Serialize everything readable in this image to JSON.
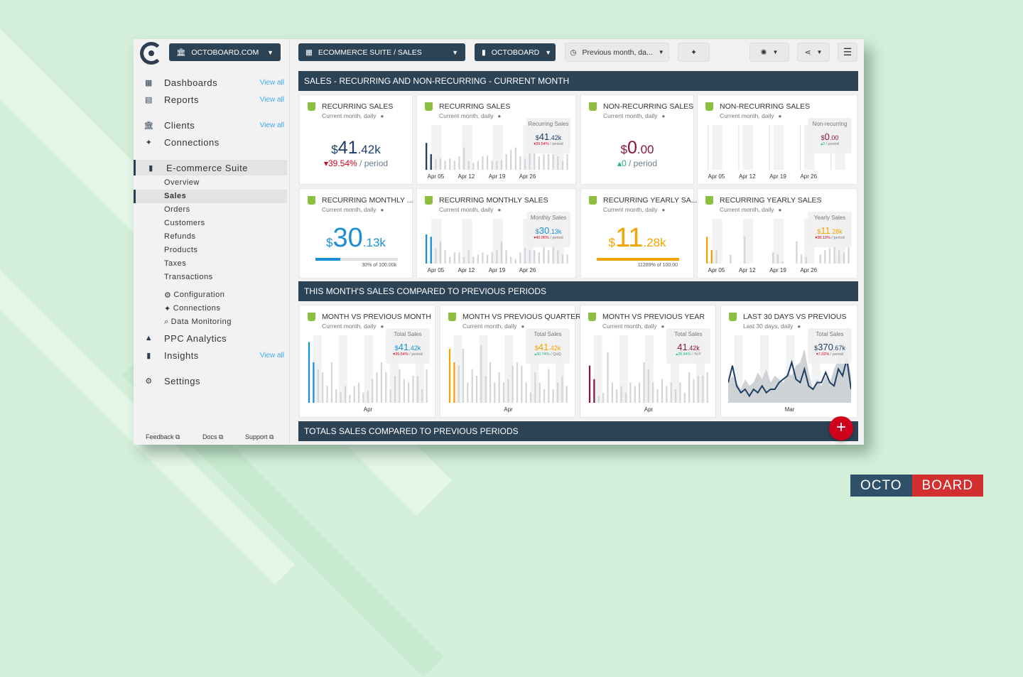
{
  "colors": {
    "dark": "#2c4356",
    "red": "#d0021b",
    "blue": "#1a8fd6",
    "orange": "#f5a300",
    "maroon": "#8a1538",
    "green": "#22b573",
    "navy": "#1d3f66"
  },
  "header": {
    "account": "OCTOBOARD.COM",
    "dashboard": "ECOMMERCE SUITE / SALES",
    "client": "OCTOBOARD",
    "period": "Previous month, da..."
  },
  "sidebar": {
    "items": [
      {
        "label": "Dashboards",
        "view": "View all",
        "icon": "dashboard-icon"
      },
      {
        "label": "Reports",
        "view": "View all",
        "icon": "report-icon"
      },
      {
        "label": "Clients",
        "view": "View all",
        "icon": "bank-icon"
      },
      {
        "label": "Connections",
        "icon": "plug-icon"
      },
      {
        "label": "E-commerce Suite",
        "icon": "shopping-bag-icon"
      }
    ],
    "sub": [
      "Overview",
      "Sales",
      "Orders",
      "Customers",
      "Refunds",
      "Products",
      "Taxes",
      "Transactions"
    ],
    "tools": [
      {
        "label": "Configuration",
        "icon": "gear-icon"
      },
      {
        "label": "Connections",
        "icon": "plug-icon"
      },
      {
        "label": "Data Monitoring",
        "icon": "search-icon"
      }
    ],
    "bottom": [
      {
        "label": "PPC Analytics",
        "icon": "ppc-icon"
      },
      {
        "label": "Insights",
        "view": "View all",
        "icon": "bar-chart-icon"
      },
      {
        "label": "Settings",
        "icon": "gear-icon"
      }
    ],
    "footer": [
      "Feedback",
      "Docs",
      "Support"
    ]
  },
  "sections": [
    "SALES - RECURRING AND NON-RECURRING - CURRENT MONTH",
    "THIS MONTH'S SALES COMPARED TO PREVIOUS PERIODS",
    "TOTALS SALES COMPARED TO PREVIOUS PERIODS"
  ],
  "cards": [
    {
      "title": "RECURRING SALES",
      "sub": "Current month, daily",
      "type": "kpi",
      "cur": "$",
      "int": "41",
      "dec": ".42k",
      "color": "#1d3f66",
      "change": "▾39.54%",
      "changeColor": "#d0021b",
      "per": " / period"
    },
    {
      "title": "RECURRING SALES",
      "sub": "Current month, daily",
      "type": "bars",
      "legend": "Recurring Sales",
      "cur": "$",
      "int": "41",
      "dec": ".42k",
      "color": "#1d3f66",
      "change": "▾39.54%",
      "changeColor": "#d0021b",
      "per": " / period",
      "xlabels": [
        "Apr 05",
        "Apr 12",
        "Apr 19",
        "Apr 26"
      ],
      "hl": 2,
      "bars": [
        0.6,
        0.35,
        0.25,
        0.25,
        0.2,
        0.25,
        0.2,
        0.3,
        0.5,
        0.2,
        0.15,
        0.2,
        0.3,
        0.32,
        0.2,
        0.2,
        0.22,
        0.35,
        0.45,
        0.5,
        0.3,
        0.25,
        0.4,
        0.45,
        0.3,
        0.35,
        0.35,
        0.35,
        0.3,
        0.2,
        0.35
      ]
    },
    {
      "title": "NON-RECURRING SALES",
      "sub": "Current month, daily",
      "type": "kpi",
      "cur": "$",
      "int": "0",
      "dec": ".00",
      "color": "#8a1538",
      "change": "▴0",
      "changeColor": "#22b573",
      "per": " / period"
    },
    {
      "title": "NON-RECURRING SALES",
      "sub": "Current month, daily",
      "type": "bars",
      "legend": "Non-recurring",
      "cur": "$",
      "int": "0",
      "dec": ".00",
      "color": "#8a1538",
      "change": "▴0",
      "changeColor": "#22b573",
      "per": " / period",
      "xlabels": [
        "Apr 05",
        "Apr 12",
        "Apr 19",
        "Apr 26"
      ],
      "hl": 0,
      "bars": []
    },
    {
      "title": "RECURRING MONTHLY ...",
      "sub": "Current month, daily",
      "type": "progress",
      "cur": "$",
      "int": "30",
      "dec": ".13k",
      "color": "#1a8fd6",
      "progress": 30,
      "progText": "30% of 100.00k"
    },
    {
      "title": "RECURRING MONTHLY SALES",
      "sub": "Current month, daily",
      "type": "bars",
      "legend": "Monthly Sales",
      "cur": "$",
      "int": "30",
      "dec": ".13k",
      "color": "#1a8fd6",
      "change": "▾40.06%",
      "changeColor": "#d0021b",
      "per": " / period",
      "xlabels": [
        "Apr 05",
        "Apr 12",
        "Apr 19",
        "Apr 26"
      ],
      "hl": 2,
      "bars": [
        0.65,
        0.6,
        0.35,
        0.5,
        0.3,
        0.15,
        0.25,
        0.25,
        0.15,
        0.3,
        0.15,
        0.2,
        0.25,
        0.2,
        0.25,
        0.3,
        0.5,
        0.3,
        0.15,
        0.1,
        0.25,
        0.35,
        0.3,
        0.3,
        0.25,
        0.4,
        0.3,
        0.45,
        0.3,
        0.2,
        0.2
      ]
    },
    {
      "title": "RECURRING YEARLY SA...",
      "sub": "Current month, daily",
      "type": "progress",
      "cur": "$",
      "int": "11",
      "dec": ".28k",
      "color": "#f5a300",
      "progress": 100,
      "progText": "11289% of 100.00"
    },
    {
      "title": "RECURRING YEARLY SALES",
      "sub": "Current month, daily",
      "type": "bars",
      "legend": "Yearly Sales",
      "cur": "$",
      "int": "11",
      "dec": ".28k",
      "color": "#f5a300",
      "change": "▾38.13%",
      "changeColor": "#d0021b",
      "per": " / period",
      "xlabels": [
        "Apr 05",
        "Apr 12",
        "Apr 19",
        "Apr 26"
      ],
      "hl": 2,
      "bars": [
        0.6,
        0.3,
        0.3,
        0,
        0,
        0.2,
        0,
        0,
        0.6,
        0,
        0,
        0,
        0,
        0,
        0.25,
        0.2,
        0.05,
        0,
        0,
        0.5,
        0.2,
        0.15,
        0,
        0,
        0.2,
        0.3,
        0.35,
        0.4,
        0.3,
        0.25,
        0.4
      ]
    },
    {
      "title": "MONTH VS PREVIOUS MONTH",
      "sub": "Current month, daily",
      "type": "bars",
      "legend": "Total Sales",
      "cur": "$",
      "int": "41",
      "dec": ".42k",
      "color": "#1a8fd6",
      "change": "▾39.54%",
      "changeColor": "#d0021b",
      "per": " / period",
      "xlabels": [
        "Apr"
      ],
      "hl": 2,
      "bars": [
        0.9,
        0.6,
        0.5,
        0.45,
        0.25,
        0.6,
        0.2,
        0.15,
        0.25,
        0.12,
        0.25,
        0.3,
        0.15,
        0.18,
        0.35,
        0.45,
        0.6,
        0.45,
        0.2,
        0.4,
        0.5,
        0.35,
        0.3,
        0.4,
        0.4,
        0.2,
        0.5
      ]
    },
    {
      "title": "MONTH VS PREVIOUS QUARTER",
      "sub": "Current month, daily",
      "type": "bars",
      "legend": "Total Sales",
      "cur": "$",
      "int": "41",
      "dec": ".42k",
      "color": "#f5a300",
      "change": "▴30.74%",
      "changeColor": "#22b573",
      "per": " / QoQ",
      "xlabels": [
        "Apr"
      ],
      "hl": 2,
      "bars": [
        0.8,
        0.6,
        0.55,
        0.8,
        0.3,
        0.5,
        0.4,
        0.85,
        0.4,
        0.6,
        0.3,
        0.45,
        0.3,
        0.35,
        0.55,
        0.6,
        0.55,
        0.3,
        0.15,
        0.45,
        0.3,
        0.2,
        0.5,
        0.2,
        0.3,
        0.4,
        0.25
      ]
    },
    {
      "title": "MONTH VS PREVIOUS YEAR",
      "sub": "Current month, daily",
      "type": "bars",
      "legend": "Total Sales",
      "cur": "",
      "int": "41",
      "dec": ".42k",
      "color": "#8a1538",
      "change": "▴28.84%",
      "changeColor": "#22b573",
      "per": " / YoY",
      "xlabels": [
        "Apr"
      ],
      "hl": 2,
      "bars": [
        0.55,
        0.35,
        0.1,
        0.15,
        0.75,
        0.3,
        0.2,
        0.25,
        0.15,
        0.3,
        0.25,
        0.3,
        0.6,
        0.5,
        0.3,
        0.2,
        0.35,
        0.25,
        0.3,
        0.2,
        0.3,
        0.15,
        0.45,
        0.35,
        0.4,
        0.4,
        0.45
      ]
    },
    {
      "title": "LAST 30 DAYS VS PREVIOUS",
      "sub": "Last 30 days, daily",
      "type": "line",
      "legend": "Total Sales",
      "cur": "$",
      "int": "370",
      "dec": ".67k",
      "color": "#1d3f66",
      "change": "▾7.02%",
      "changeColor": "#d0021b",
      "per": " / period",
      "xlabels": [
        "Mar"
      ],
      "line": [
        0.3,
        0.55,
        0.25,
        0.15,
        0.2,
        0.1,
        0.2,
        0.15,
        0.25,
        0.15,
        0.2,
        0.2,
        0.3,
        0.35,
        0.4,
        0.6,
        0.35,
        0.3,
        0.5,
        0.25,
        0.2,
        0.3,
        0.3,
        0.45,
        0.3,
        0.25,
        0.5,
        0.4,
        0.65,
        0.2
      ],
      "area": [
        0.3,
        0.4,
        0.3,
        0.2,
        0.35,
        0.25,
        0.3,
        0.45,
        0.35,
        0.5,
        0.3,
        0.4,
        0.35,
        0.3,
        0.45,
        0.4,
        0.55,
        0.6,
        0.8,
        0.45,
        0.2,
        0.35,
        0.25,
        0.4,
        0.3,
        0.5,
        0.65,
        0.9,
        0.75,
        0.4
      ]
    }
  ],
  "fab": "+",
  "brand": {
    "left": "OCTO",
    "right": "BOARD"
  }
}
